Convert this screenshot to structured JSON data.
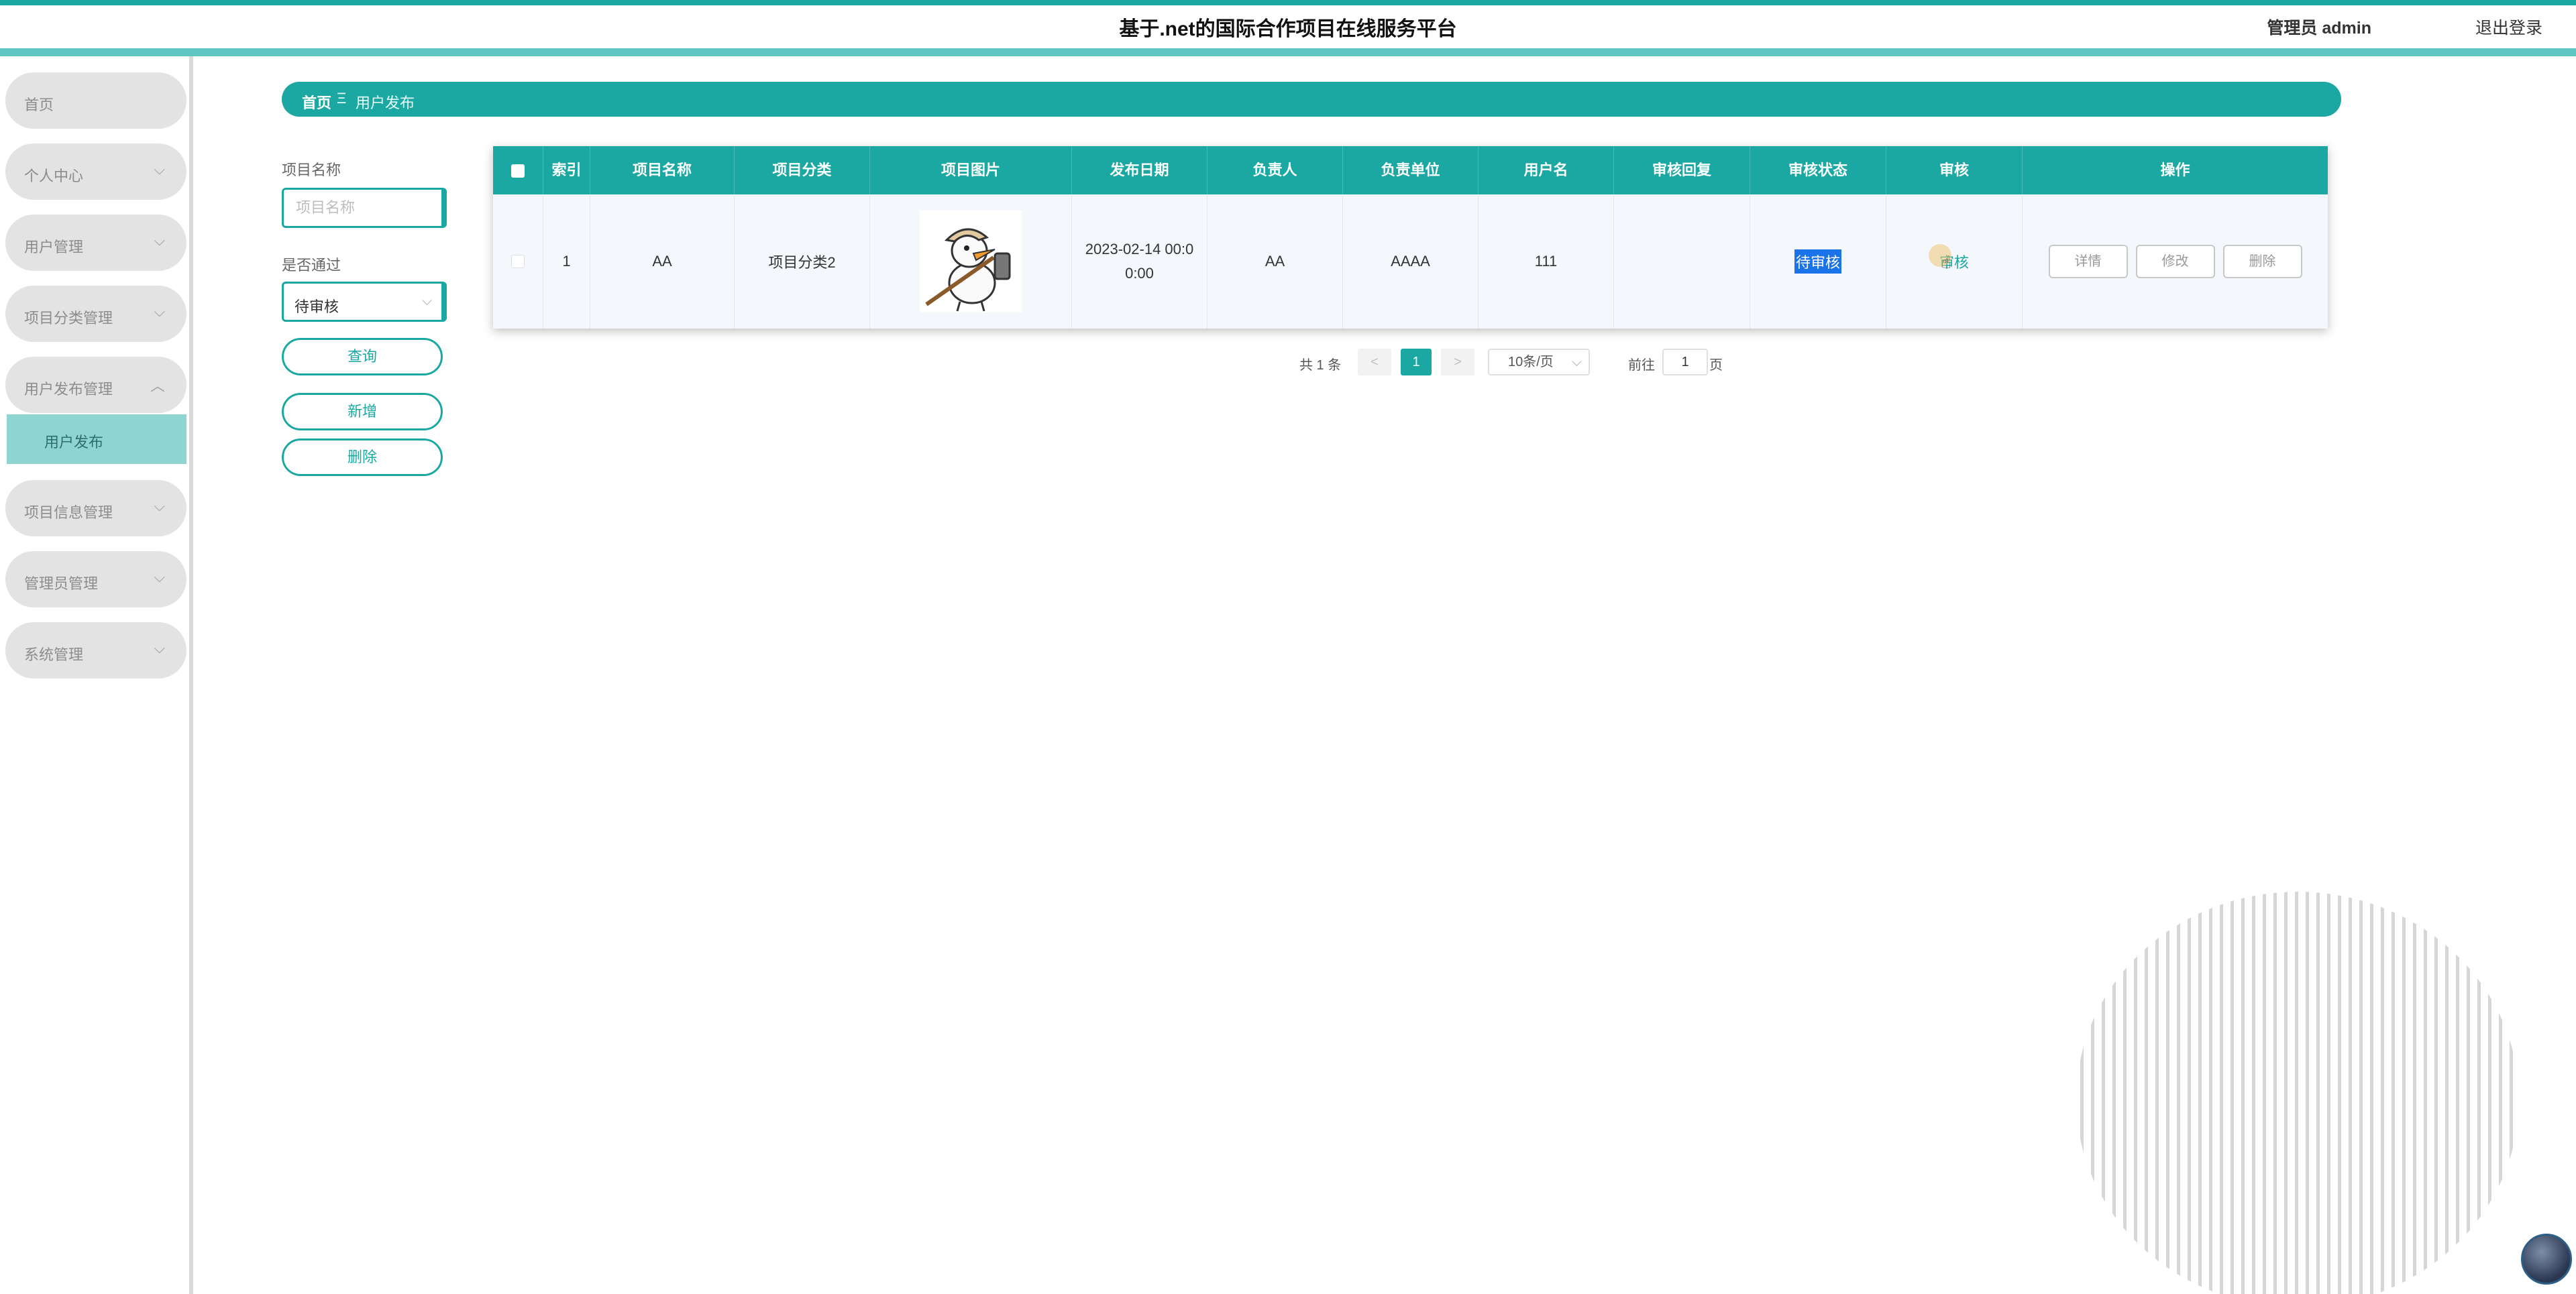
{
  "header": {
    "title": "基于.net的国际合作项目在线服务平台",
    "user_label": "管理员 admin",
    "logout": "退出登录",
    "brand_color": "#1ba8a2"
  },
  "sidebar": {
    "items": [
      {
        "label": "首页",
        "chevron": ""
      },
      {
        "label": "个人中心",
        "chevron": "⌵"
      },
      {
        "label": "用户管理",
        "chevron": "⌵"
      },
      {
        "label": "项目分类管理",
        "chevron": "⌵"
      },
      {
        "label": "用户发布管理",
        "chevron": "︿"
      },
      {
        "label": "项目信息管理",
        "chevron": "⌵"
      },
      {
        "label": "管理员管理",
        "chevron": "⌵"
      },
      {
        "label": "系统管理",
        "chevron": "⌵"
      }
    ],
    "sub_item": "用户发布"
  },
  "breadcrumb": {
    "home": "首页",
    "separator": "Ξ",
    "current": "用户发布"
  },
  "search": {
    "name_label": "项目名称",
    "name_placeholder": "项目名称",
    "pass_label": "是否通过",
    "pass_value": "待审核",
    "query_button": "查询",
    "add_button": "新增",
    "delete_button": "删除"
  },
  "table": {
    "headers": [
      "索引",
      "项目名称",
      "项目分类",
      "项目图片",
      "发布日期",
      "负责人",
      "负责单位",
      "用户名",
      "审核回复",
      "审核状态",
      "审核",
      "操作"
    ],
    "rows": [
      {
        "index": "1",
        "name": "AA",
        "category": "项目分类2",
        "date": "2023-02-14 00:00:00",
        "manager": "AA",
        "unit": "AAAA",
        "username": "111",
        "reply": "",
        "status": "待审核",
        "audit": "审核",
        "actions": {
          "detail": "详情",
          "edit": "修改",
          "delete": "删除"
        }
      }
    ]
  },
  "pagination": {
    "total": "共 1 条",
    "prev": "<",
    "current_page": "1",
    "next": ">",
    "page_size": "10条/页",
    "goto_label": "前往",
    "goto_value": "1",
    "goto_unit": "页"
  }
}
